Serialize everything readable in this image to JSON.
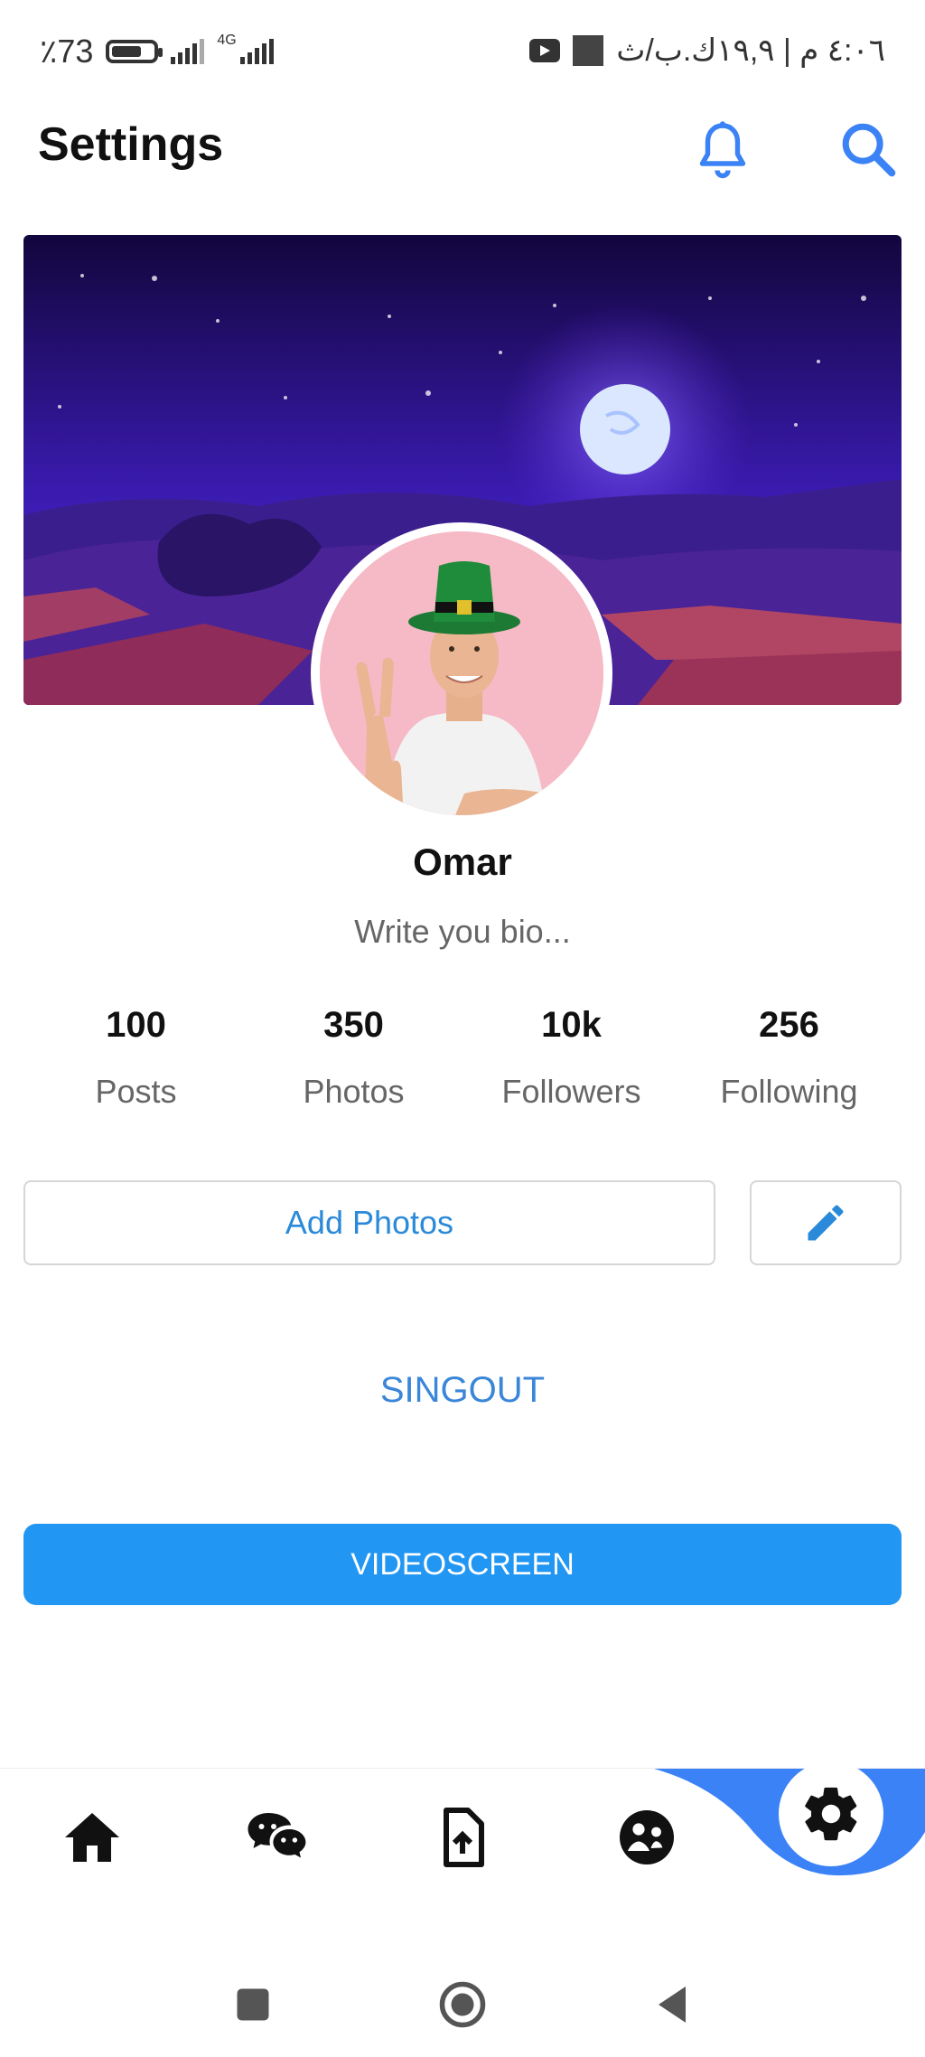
{
  "status_bar": {
    "battery": "٪73",
    "battery_level": 0.73,
    "network": "4G",
    "datetime": "٤:٠٦ م | ١٩,٩ك.ب/ث"
  },
  "header": {
    "title": "Settings",
    "icons": [
      "bell-icon",
      "search-icon"
    ]
  },
  "profile": {
    "name": "Omar",
    "bio_placeholder": "Write you bio...",
    "stats": [
      {
        "value": "100",
        "label": "Posts"
      },
      {
        "value": "350",
        "label": "Photos"
      },
      {
        "value": "10k",
        "label": "Followers"
      },
      {
        "value": "256",
        "label": "Following"
      }
    ]
  },
  "actions": {
    "add_photos": "Add Photos",
    "edit_icon": "pencil-icon",
    "signout": "SINGOUT",
    "videoscreen": "VIDEOSCREEN"
  },
  "bottom_nav": {
    "items": [
      "home-icon",
      "chat-icon",
      "upload-file-icon",
      "community-icon",
      "settings-icon"
    ],
    "active": "settings-icon"
  },
  "colors": {
    "accent": "#2196f3",
    "link": "#3a86d8",
    "icon_blue": "#3b82f6",
    "nav_curve": "#3b82f6"
  }
}
